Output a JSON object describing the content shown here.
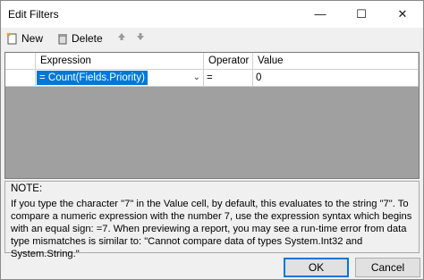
{
  "window": {
    "title": "Edit Filters"
  },
  "toolbar": {
    "new_label": "New",
    "delete_label": "Delete"
  },
  "grid": {
    "columns": [
      "Expression",
      "Operator",
      "Value"
    ],
    "rows": [
      {
        "expression": "= Count(Fields.Priority)",
        "operator": "=",
        "value": "0"
      }
    ]
  },
  "note": {
    "title": "NOTE:",
    "text": "If you type the character \"7\" in the Value cell, by default, this evaluates to the string \"7\". To compare a numeric expression with the number 7, use the expression syntax which begins with an equal sign: =7. When previewing a report, you may see a run-time error from data type mismatches is similar to: \"Cannot compare data of types System.Int32 and System.String.\""
  },
  "buttons": {
    "ok_label": "OK",
    "cancel_label": "Cancel"
  },
  "colors": {
    "selection": "#0078d7",
    "grid_bg": "#a0a0a0",
    "window_bg": "#f0f0f0"
  },
  "icons": {
    "new": "new-document-icon",
    "delete": "trash-icon",
    "up": "arrow-up-icon",
    "down": "arrow-down-icon"
  }
}
